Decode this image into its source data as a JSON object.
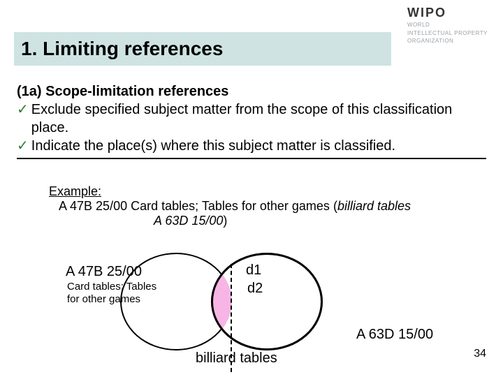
{
  "logo": {
    "name": "WIPO",
    "line1": "WORLD",
    "line2": "INTELLECTUAL PROPERTY",
    "line3": "ORGANIZATION"
  },
  "title": "1. Limiting references",
  "section_heading": "(1a) Scope-limitation references",
  "bullets": {
    "b1": "Exclude specified subject matter from the scope of this classification place.",
    "b2": "Indicate the place(s) where this subject matter is classified."
  },
  "example": {
    "label": "Example:",
    "code1": "A 47B 25/00",
    "desc1": "Card tables; Tables for other games",
    "paren_open": "(",
    "ital1": "billiard tables",
    "ital2": "A 63D 15/00",
    "paren_close": ")"
  },
  "venn": {
    "left_code": "A 47B 25/00",
    "left_sub": "Card tables; Tables for other games",
    "d1": "d1",
    "d2": "d2",
    "bottom": "billiard tables",
    "right_code": "A 63D 15/00"
  },
  "page": "34"
}
